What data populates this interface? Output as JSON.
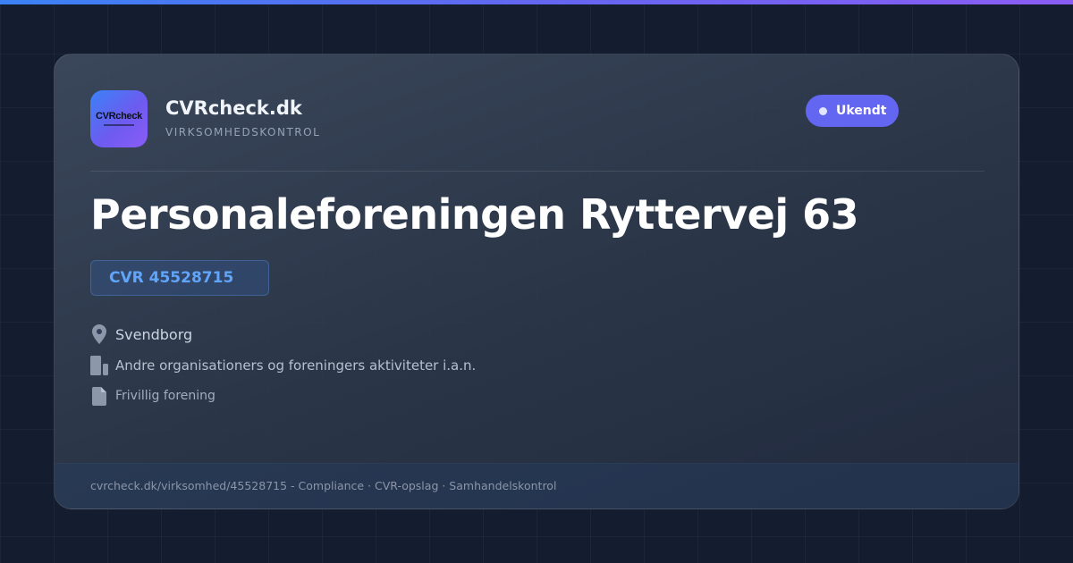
{
  "brand": {
    "logo_text": "CVRcheck",
    "name": "CVRcheck.dk",
    "tagline": "VIRKSOMHEDSKONTROL",
    "accent": "#6366f1"
  },
  "status": {
    "label": "Ukendt",
    "color": "#6366f1"
  },
  "company": {
    "name": "Personaleforeningen Ryttervej 63",
    "cvr": "CVR 45528715",
    "location": "Svendborg",
    "industry": "Andre organisationers og foreningers aktiviteter i.a.n.",
    "legal_form": "Frivillig forening"
  },
  "icons": {
    "location": "map-pin-icon",
    "industry": "building-icon",
    "legal_form": "document-icon"
  },
  "footer": {
    "text": "cvrcheck.dk/virksomhed/45528715 - Compliance · CVR-opslag · Samhandelskontrol"
  }
}
